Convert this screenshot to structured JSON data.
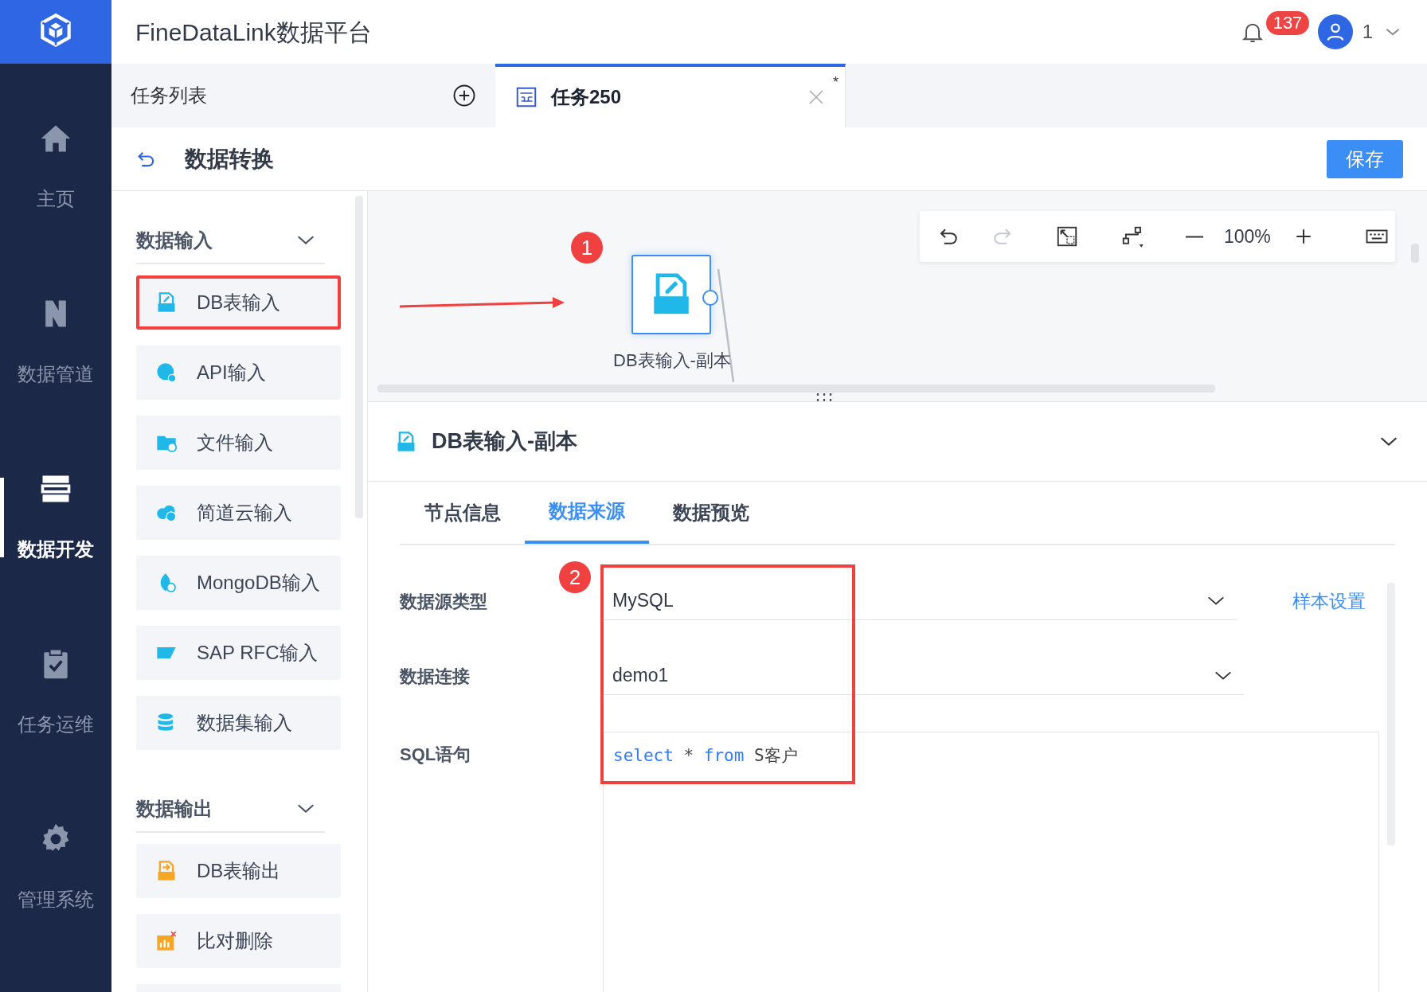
{
  "app": {
    "title": "FineDataLink数据平台",
    "notification_count": "137",
    "user": "1"
  },
  "nav": [
    {
      "label": "主页",
      "selected": false
    },
    {
      "label": "数据管道",
      "selected": false
    },
    {
      "label": "数据开发",
      "selected": true
    },
    {
      "label": "任务运维",
      "selected": false
    },
    {
      "label": "管理系统",
      "selected": false
    }
  ],
  "tabs": [
    {
      "label": "任务列表",
      "kind": "list",
      "selected": false
    },
    {
      "label": "任务250",
      "kind": "task",
      "selected": true,
      "modified_mark": "*"
    }
  ],
  "header": {
    "title": "数据转换",
    "save_button": "保存"
  },
  "palette": [
    {
      "title": "数据输入",
      "expanded": true,
      "items": [
        {
          "label": "DB表输入",
          "highlighted": true
        },
        {
          "label": "API输入",
          "highlighted": false
        },
        {
          "label": "文件输入",
          "highlighted": false
        },
        {
          "label": "简道云输入",
          "highlighted": false
        },
        {
          "label": "MongoDB输入",
          "highlighted": false
        },
        {
          "label": "SAP RFC输入",
          "highlighted": false
        },
        {
          "label": "数据集输入",
          "highlighted": false
        }
      ]
    },
    {
      "title": "数据输出",
      "expanded": true,
      "items": [
        {
          "label": "DB表输出",
          "highlighted": false
        },
        {
          "label": "比对删除",
          "highlighted": false
        },
        {
          "highlighted": false
        }
      ]
    }
  ],
  "canvas": {
    "zoom": "100%",
    "node": {
      "label": "DB表输入-副本"
    },
    "callout": "1"
  },
  "panel": {
    "title": "DB表输入-副本",
    "expanded": true,
    "tabs": [
      {
        "label": "节点信息",
        "selected": false
      },
      {
        "label": "数据来源",
        "selected": true
      },
      {
        "label": "数据预览",
        "selected": false
      }
    ],
    "callout": "2",
    "form": {
      "source_type_label": "数据源类型",
      "source_type": "MySQL",
      "sample_link": "样本设置",
      "connection_label": "数据连接",
      "connection": "demo1",
      "sql_label": "SQL语句",
      "sql": [
        {
          "kind": "keyword",
          "text": "select"
        },
        {
          "kind": "plain",
          "text": " * "
        },
        {
          "kind": "keyword",
          "text": "from"
        },
        {
          "kind": "plain",
          "text": " S客户"
        }
      ]
    }
  }
}
